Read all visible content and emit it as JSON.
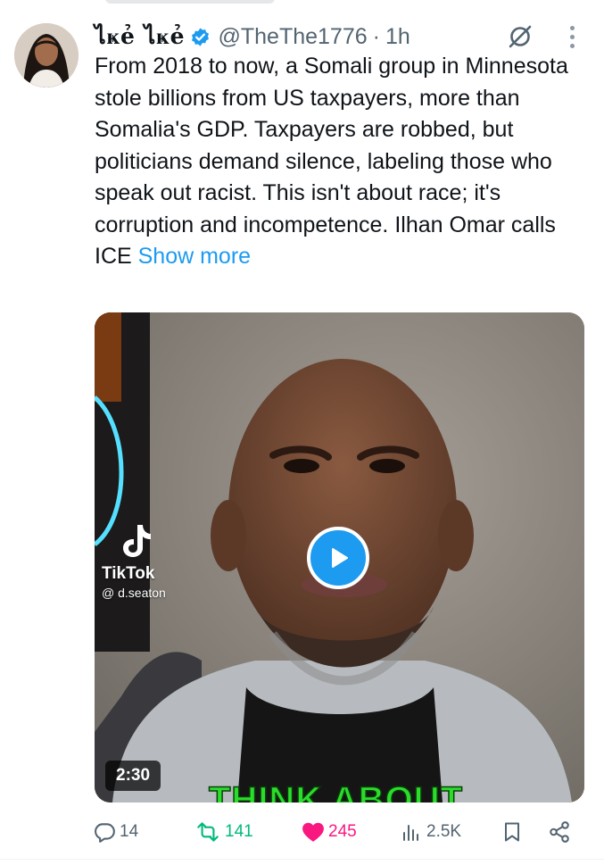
{
  "tweet": {
    "author_name": "ไҝẻ ไҝẻ",
    "handle": "@TheThe1776",
    "separator": "·",
    "time_ago": "1h",
    "text": "From 2018 to now, a Somali group in Minnesota stole billions from US taxpayers, more than Somalia's GDP.  Taxpayers are robbed, but politicians demand silence, labeling those who speak out racist.  This isn't about race; it's corruption and incompetence.  Ilhan Omar calls ICE ",
    "show_more": "Show more",
    "verified": true
  },
  "media": {
    "type": "video",
    "duration": "2:30",
    "watermark_brand": "TikTok",
    "watermark_user": "@ d.seaton",
    "caption_partial": "THINK ABOUT"
  },
  "actions": {
    "replies": "14",
    "reposts": "141",
    "likes": "245",
    "views": "2.5K"
  },
  "icons": {
    "reply": "speech-bubble-icon",
    "repost": "repost-arrows-icon",
    "like": "heart-icon",
    "views": "bar-chart-icon",
    "bookmark": "bookmark-icon",
    "share": "share-icon",
    "grok": "grok-slash-icon",
    "more": "vertical-dots-icon",
    "verified": "verified-badge-icon",
    "play": "play-icon"
  },
  "colors": {
    "accent": "#1d9bf0",
    "repost": "#00ba7c",
    "like": "#f91880",
    "muted": "#536471",
    "caption": "#2bdc2b"
  }
}
